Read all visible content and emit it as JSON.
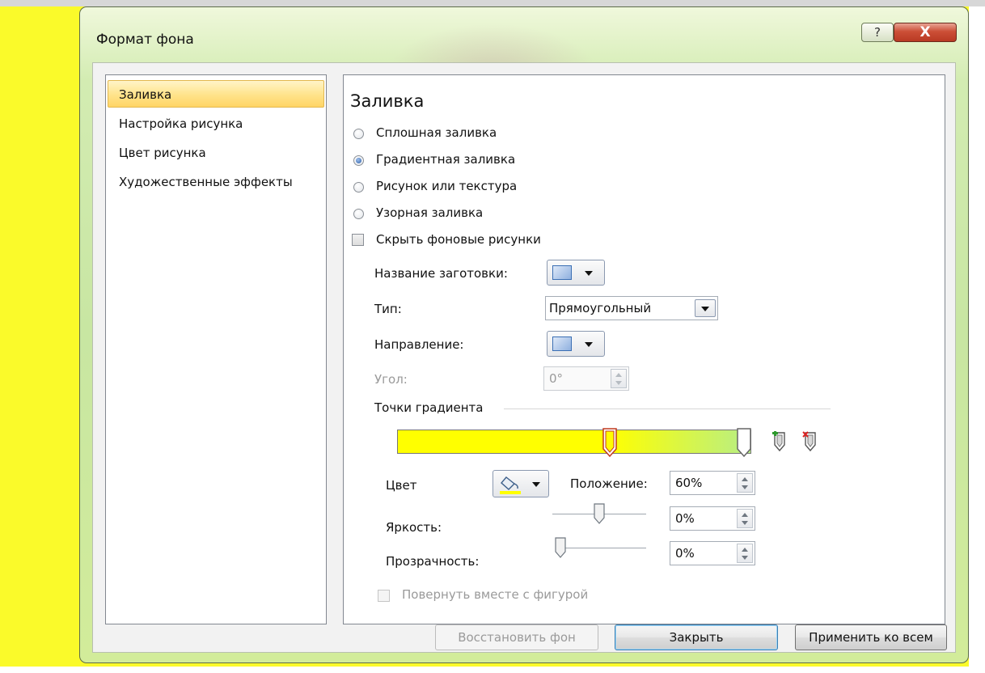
{
  "dialog": {
    "title": "Формат фона",
    "help_glyph": "?",
    "close_glyph": "X"
  },
  "nav": {
    "items": [
      {
        "label": "Заливка",
        "selected": true
      },
      {
        "label": "Настройка рисунка",
        "selected": false
      },
      {
        "label": "Цвет рисунка",
        "selected": false
      },
      {
        "label": "Художественные эффекты",
        "selected": false
      }
    ]
  },
  "fill": {
    "section_title": "Заливка",
    "options": [
      {
        "label": "Сплошная заливка",
        "checked": false
      },
      {
        "label": "Градиентная заливка",
        "checked": true
      },
      {
        "label": "Рисунок или текстура",
        "checked": false
      },
      {
        "label": "Узорная заливка",
        "checked": false
      }
    ],
    "hide_background_label": "Скрыть фоновые рисунки",
    "hide_background_checked": false,
    "preset_label": "Название заготовки:",
    "type_label": "Тип:",
    "type_value": "Прямоугольный",
    "direction_label": "Направление:",
    "angle_label": "Угол:",
    "angle_value": "0°",
    "stops_label": "Точки градиента",
    "gradient": {
      "start_color": "#ffff00",
      "end_color": "#b7ee86",
      "stops": [
        {
          "position": 0.6,
          "selected": true
        },
        {
          "position": 1.0,
          "selected": false
        }
      ]
    },
    "color_label": "Цвет",
    "fill_icon_color": "#ffff00",
    "position_label": "Положение:",
    "position_value": "60%",
    "brightness_label": "Яркость:",
    "brightness_value": "0%",
    "brightness_level": 0.5,
    "transparency_label": "Прозрачность:",
    "transparency_value": "0%",
    "transparency_level": 0.0,
    "rotate_label": "Повернуть вместе с фигурой"
  },
  "buttons": {
    "reset": "Восстановить фон",
    "close": "Закрыть",
    "apply_all": "Применить ко всем"
  }
}
